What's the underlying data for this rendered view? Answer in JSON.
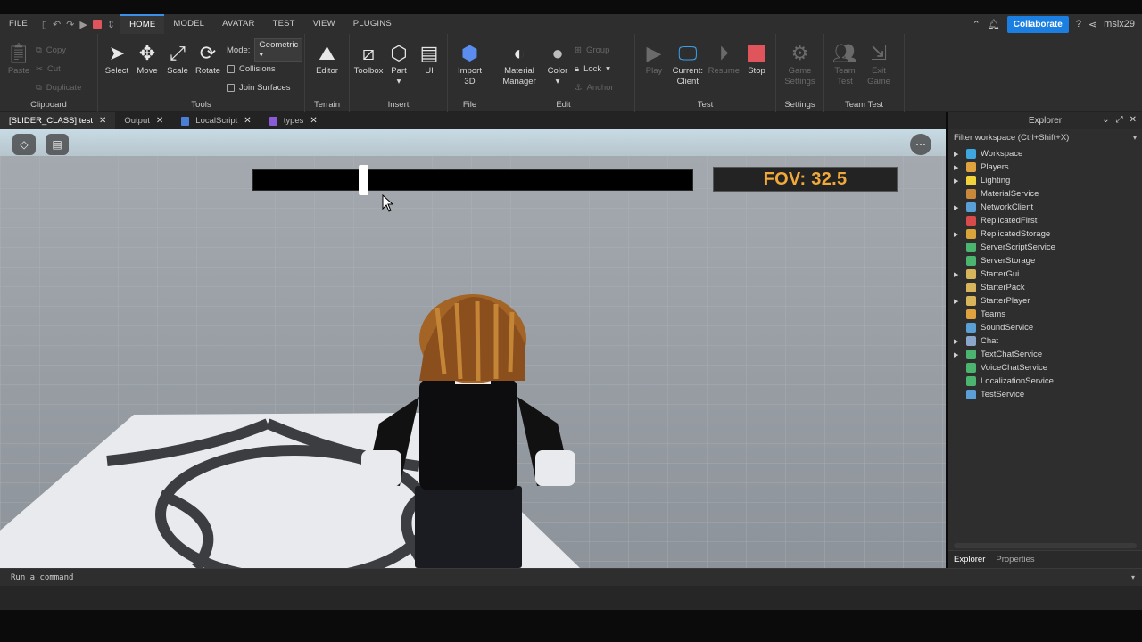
{
  "menu": {
    "file": "FILE",
    "tabs": [
      "HOME",
      "MODEL",
      "AVATAR",
      "TEST",
      "VIEW",
      "PLUGINS"
    ],
    "active_tab": "HOME",
    "collaborate": "Collaborate",
    "username": "msix29"
  },
  "ribbon": {
    "clipboard": {
      "label": "Clipboard",
      "paste": "Paste",
      "copy": "Copy",
      "cut": "Cut",
      "duplicate": "Duplicate"
    },
    "tools": {
      "label": "Tools",
      "select": "Select",
      "move": "Move",
      "scale": "Scale",
      "rotate": "Rotate",
      "mode_label": "Mode:",
      "mode_value": "Geometric",
      "collisions": "Collisions",
      "join_surfaces": "Join Surfaces"
    },
    "terrain": {
      "label": "Terrain",
      "editor": "Editor"
    },
    "insert": {
      "label": "Insert",
      "toolbox": "Toolbox",
      "part": "Part",
      "ui": "UI"
    },
    "file": {
      "label": "File",
      "import3d": "Import 3D"
    },
    "edit": {
      "label": "Edit",
      "material_manager": "Material Manager",
      "color": "Color",
      "group": "Group",
      "lock": "Lock",
      "anchor": "Anchor"
    },
    "test": {
      "label": "Test",
      "play": "Play",
      "current_client": "Current: Client",
      "resume": "Resume",
      "stop": "Stop"
    },
    "settings": {
      "label": "Settings",
      "game_settings": "Game Settings"
    },
    "team_test": {
      "label": "Team Test",
      "team_test": "Team Test",
      "exit_game": "Exit Game"
    }
  },
  "doc_tabs": [
    {
      "label": "[SLIDER_CLASS] test",
      "active": true
    },
    {
      "label": "Output",
      "active": false
    },
    {
      "label": "LocalScript",
      "active": false
    },
    {
      "label": "types",
      "active": false
    }
  ],
  "viewport": {
    "fov_text": "FOV: 32.5",
    "slider_value": 0.25
  },
  "explorer": {
    "title": "Explorer",
    "filter_placeholder": "Filter workspace (Ctrl+Shift+X)",
    "items": [
      {
        "label": "Workspace",
        "expandable": true,
        "color": "#3fa7e0"
      },
      {
        "label": "Players",
        "expandable": true,
        "color": "#e0a23f"
      },
      {
        "label": "Lighting",
        "expandable": true,
        "color": "#f2d23a"
      },
      {
        "label": "MaterialService",
        "expandable": false,
        "color": "#c9883a"
      },
      {
        "label": "NetworkClient",
        "expandable": true,
        "color": "#5aa0d6"
      },
      {
        "label": "ReplicatedFirst",
        "expandable": false,
        "color": "#d94b4b"
      },
      {
        "label": "ReplicatedStorage",
        "expandable": true,
        "color": "#d9a43a"
      },
      {
        "label": "ServerScriptService",
        "expandable": false,
        "color": "#4bb46e"
      },
      {
        "label": "ServerStorage",
        "expandable": false,
        "color": "#4bb46e"
      },
      {
        "label": "StarterGui",
        "expandable": true,
        "color": "#d8b45a"
      },
      {
        "label": "StarterPack",
        "expandable": false,
        "color": "#d8b45a"
      },
      {
        "label": "StarterPlayer",
        "expandable": true,
        "color": "#d8b45a"
      },
      {
        "label": "Teams",
        "expandable": false,
        "color": "#e0a23f"
      },
      {
        "label": "SoundService",
        "expandable": false,
        "color": "#5aa0d6"
      },
      {
        "label": "Chat",
        "expandable": true,
        "color": "#8aa6c8"
      },
      {
        "label": "TextChatService",
        "expandable": true,
        "color": "#4bb46e"
      },
      {
        "label": "VoiceChatService",
        "expandable": false,
        "color": "#4bb46e"
      },
      {
        "label": "LocalizationService",
        "expandable": false,
        "color": "#4bb46e"
      },
      {
        "label": "TestService",
        "expandable": false,
        "color": "#5aa0d6"
      }
    ],
    "bottom_tabs": [
      "Explorer",
      "Properties"
    ]
  },
  "command_bar": {
    "placeholder": "Run a command"
  }
}
